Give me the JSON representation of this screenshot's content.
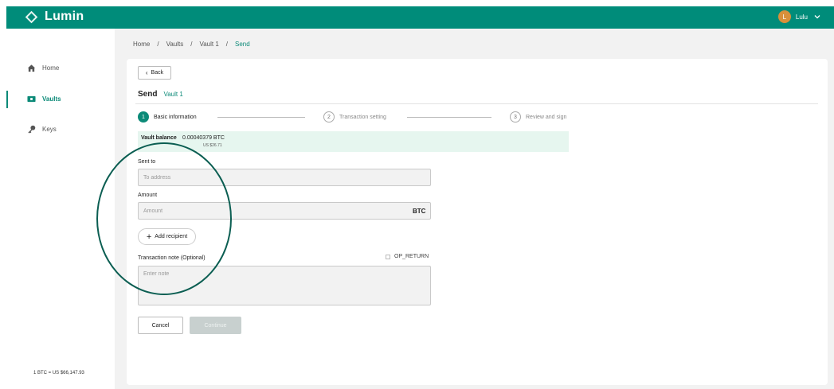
{
  "app": {
    "name": "Lumin",
    "brand_color": "#008C7A",
    "accent_color": "#0c8a78"
  },
  "user": {
    "initial": "L",
    "name": "Lulu",
    "avatar_color": "#D8903A",
    "menu_icon": "chevron-down-icon"
  },
  "sidebar": {
    "items": [
      {
        "label": "Home",
        "icon": "home-icon",
        "active": false
      },
      {
        "label": "Vaults",
        "icon": "vault-icon",
        "active": true
      },
      {
        "label": "Keys",
        "icon": "key-icon",
        "active": false
      }
    ],
    "rate": "1 BTC = US $66,147.93"
  },
  "breadcrumb": [
    "Home",
    "/",
    "Vaults",
    "/",
    "Vault 1",
    "/",
    "Send"
  ],
  "page": {
    "back_label": "Back",
    "title": "Send",
    "vault_name": "Vault 1"
  },
  "steps": [
    {
      "num": "1",
      "label": "Basic information",
      "active": true
    },
    {
      "num": "2",
      "label": "Transaction setting",
      "active": false
    },
    {
      "num": "3",
      "label": "Review and sign",
      "active": false
    }
  ],
  "balance": {
    "label": "Vault balance",
    "btc": "0.00040379 BTC",
    "usd": "US $26.71"
  },
  "form": {
    "send_to_label": "Sent to",
    "address_placeholder": "To address",
    "amount_label": "Amount",
    "amount_placeholder": "Amount",
    "amount_unit": "BTC",
    "add_recipient_label": "Add recipient",
    "note_label": "Transaction note (Optional)",
    "op_return_label": "OP_RETURN",
    "note_placeholder": "Enter note"
  },
  "actions": {
    "cancel": "Cancel",
    "continue": "Continue"
  }
}
